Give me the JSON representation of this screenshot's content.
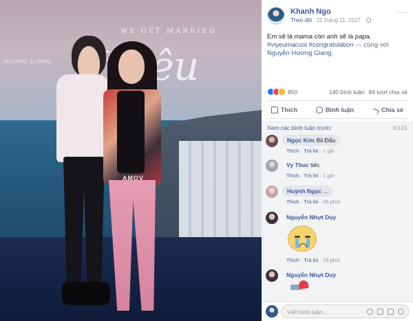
{
  "photo": {
    "banner_top": "WE GET MARRIED",
    "banner_script": "Vi yêu cưới",
    "banner_brand": "HUONG GIANG",
    "jacket_text": "AMOV"
  },
  "post": {
    "author": "Khanh Ngo",
    "follow": "Theo dõi",
    "date": "21 tháng 11, 2017",
    "more": "···",
    "caption": {
      "line1": "Em sẽ là mama còn anh sẽ là papa.",
      "hashtag1": "#viyeumacuoi",
      "hashtag2": "#congratulation",
      "with_text": "— cùng với",
      "tagged": "Nguyễn Hương Giang."
    },
    "reactions_count": "850",
    "comments_count": "140 bình luận",
    "shares_count": "84 lượt chia sẻ",
    "actions": {
      "like": "Thích",
      "comment": "Bình luận",
      "share": "Chia sẻ"
    }
  },
  "comments": {
    "previous_label": "Xem các bình luận trước",
    "previous_count": "6/101",
    "items": [
      {
        "name": "Ngọc Kim",
        "text": "Bii Đẩu",
        "like": "Thích",
        "reply": "Trả lời",
        "time": "1 giờ"
      },
      {
        "name": "Vy Thuc",
        "text": "tiếc",
        "like": "Thích",
        "reply": "Trả lời",
        "time": "1 giờ"
      },
      {
        "name": "Huỳnh Ngọc",
        "text": "...",
        "like": "Thích",
        "reply": "Trả lời",
        "time": "46 phút"
      },
      {
        "name": "Nguyễn Nhựt Duy",
        "text": "",
        "like": "Thích",
        "reply": "Trả lời",
        "time": "29 phút"
      },
      {
        "name": "Nguyễn Nhựt Duy",
        "text": ""
      }
    ]
  },
  "composer": {
    "placeholder": "Viết bình luận..."
  },
  "colors": {
    "link": "#385898",
    "like": "#1877f2",
    "love": "#f33e58",
    "haha": "#f7b928"
  }
}
